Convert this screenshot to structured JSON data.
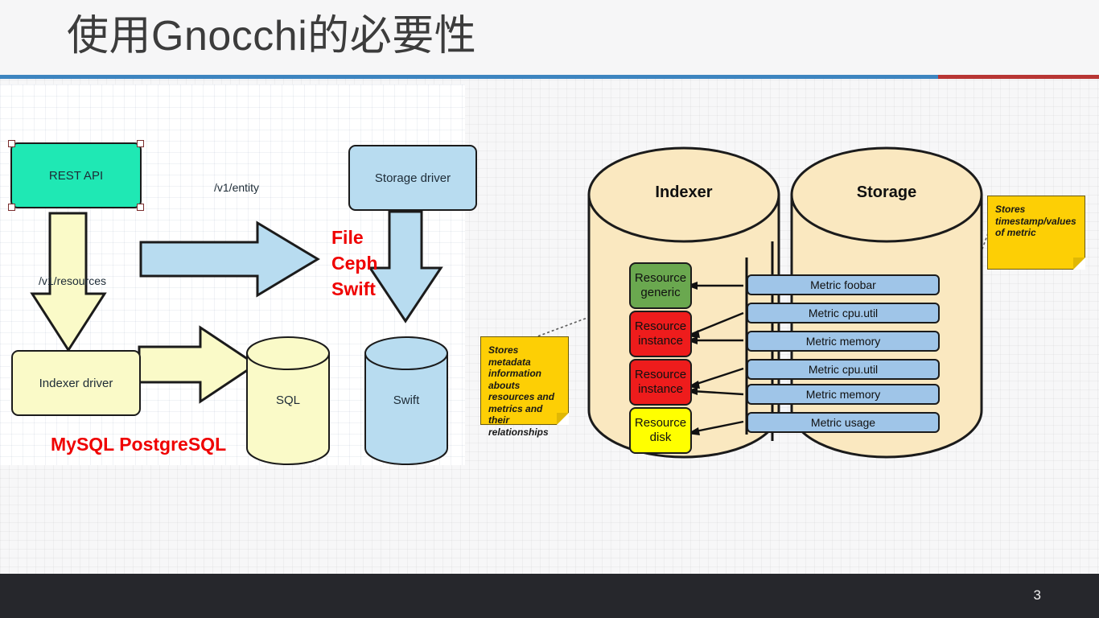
{
  "slide": {
    "title": "使用Gnocchi的必要性",
    "page_number": "3",
    "accent_blue": "#3d85c0",
    "accent_red": "#b83634",
    "footer_bg": "#26272c"
  },
  "left_diagram": {
    "nodes": {
      "rest_api": {
        "label": "REST API",
        "color": "#1fe8b4"
      },
      "storage_driver": {
        "label": "Storage driver",
        "color": "#b8dcf0"
      },
      "indexer_driver": {
        "label": "Indexer driver",
        "color": "#fafac8"
      },
      "sql_cylinder": {
        "label": "SQL",
        "color": "#fafac8"
      },
      "swift_cylinder": {
        "label": "Swift",
        "color": "#b8dcf0"
      }
    },
    "edges": {
      "entity": {
        "label": "/v1/entity",
        "color": "#b8dcf0"
      },
      "resources": {
        "label": "/v1/resources",
        "color": "#fafac8"
      }
    },
    "annotations": {
      "storage_backends": [
        "File",
        "Ceph",
        "Swift"
      ],
      "indexer_backends": "MySQL PostgreSQL",
      "annotation_color": "#ef0000"
    }
  },
  "right_diagram": {
    "indexer": {
      "title": "Indexer",
      "resources": [
        {
          "label_line1": "Resource",
          "label_line2": "generic",
          "color": "#6aa84f"
        },
        {
          "label_line1": "Resource",
          "label_line2": "instance",
          "color": "#ee1c1c"
        },
        {
          "label_line1": "Resource",
          "label_line2": "instance",
          "color": "#ee1c1c"
        },
        {
          "label_line1": "Resource",
          "label_line2": "disk",
          "color": "#ffff00"
        }
      ]
    },
    "storage": {
      "title": "Storage",
      "metrics": [
        {
          "label": "Metric foobar"
        },
        {
          "label": "Metric cpu.util"
        },
        {
          "label": "Metric memory"
        },
        {
          "label": "Metric cpu.util"
        },
        {
          "label": "Metric memory"
        },
        {
          "label": "Metric usage"
        }
      ]
    },
    "cylinder_color": "#fae8c0",
    "metric_color": "#9fc5e8"
  },
  "sticky_notes": {
    "indexer_note": "Stores metadata information abouts resources and metrics and their relationships",
    "storage_note": "Stores timestamp/values of metric",
    "color": "#fdcf05"
  }
}
